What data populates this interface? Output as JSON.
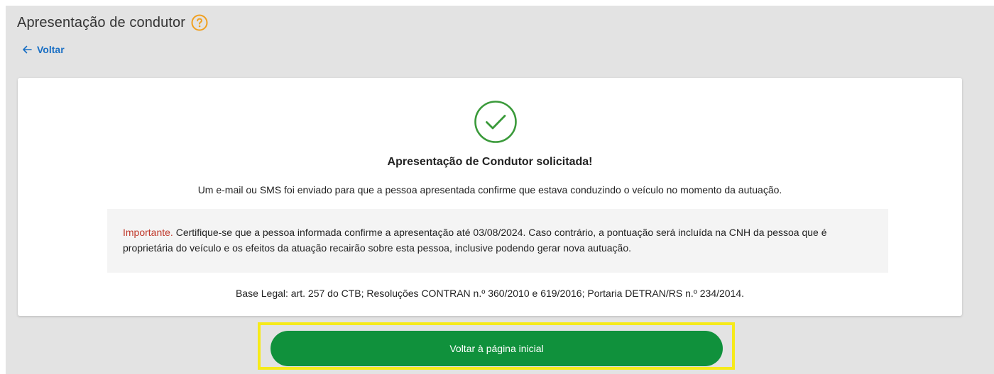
{
  "header": {
    "title": "Apresentação de condutor",
    "help_icon": "question-circle-icon",
    "help_color": "#f0a020"
  },
  "nav": {
    "back_label": "Voltar",
    "back_icon": "arrow-left-icon"
  },
  "result": {
    "icon": "check-circle-icon",
    "icon_color": "#3a9a3a",
    "title": "Apresentação de Condutor solicitada!",
    "message": "Um e-mail ou SMS foi enviado para que a pessoa apresentada confirme que estava conduzindo o veículo no momento da autuação."
  },
  "notice": {
    "label": "Importante.",
    "label_color": "#c0392b",
    "text": " Certifique-se que a pessoa informada confirme a apresentação até 03/08/2024. Caso contrário, a pontuação será incluída na CNH da pessoa que é proprietária do veículo e os efeitos da atuação recairão sobre esta pessoa, inclusive podendo gerar nova autuação."
  },
  "legal": {
    "text": "Base Legal: art. 257 do CTB; Resoluções CONTRAN n.º 360/2010 e 619/2016; Portaria DETRAN/RS n.º 234/2014."
  },
  "actions": {
    "home_label": "Voltar à página inicial",
    "button_color": "#10913c",
    "highlight_color": "#f6ea1a"
  }
}
